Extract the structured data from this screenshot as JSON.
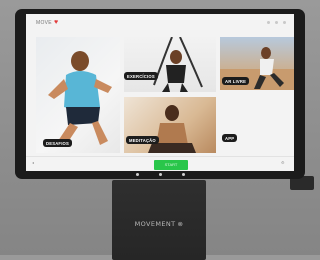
{
  "device": {
    "brand": "MOVEMENT",
    "brand_mark": "⊗"
  },
  "screen": {
    "logo": "MOVE",
    "heart": "♥",
    "tiles": [
      {
        "key": "main",
        "label": "DESAFIOS"
      },
      {
        "key": "exercises",
        "label": "EXERCÍCIOS"
      },
      {
        "key": "outdoor",
        "label": "AR LIVRE"
      },
      {
        "key": "meditation",
        "label": "MEDITAÇÃO"
      },
      {
        "key": "app",
        "label": "APP"
      }
    ],
    "bottom": {
      "left_icon": "◂",
      "start_label": "START",
      "right_icon": "⚙"
    }
  },
  "colors": {
    "accent": "#29c64a",
    "heart": "#e23a3a"
  }
}
